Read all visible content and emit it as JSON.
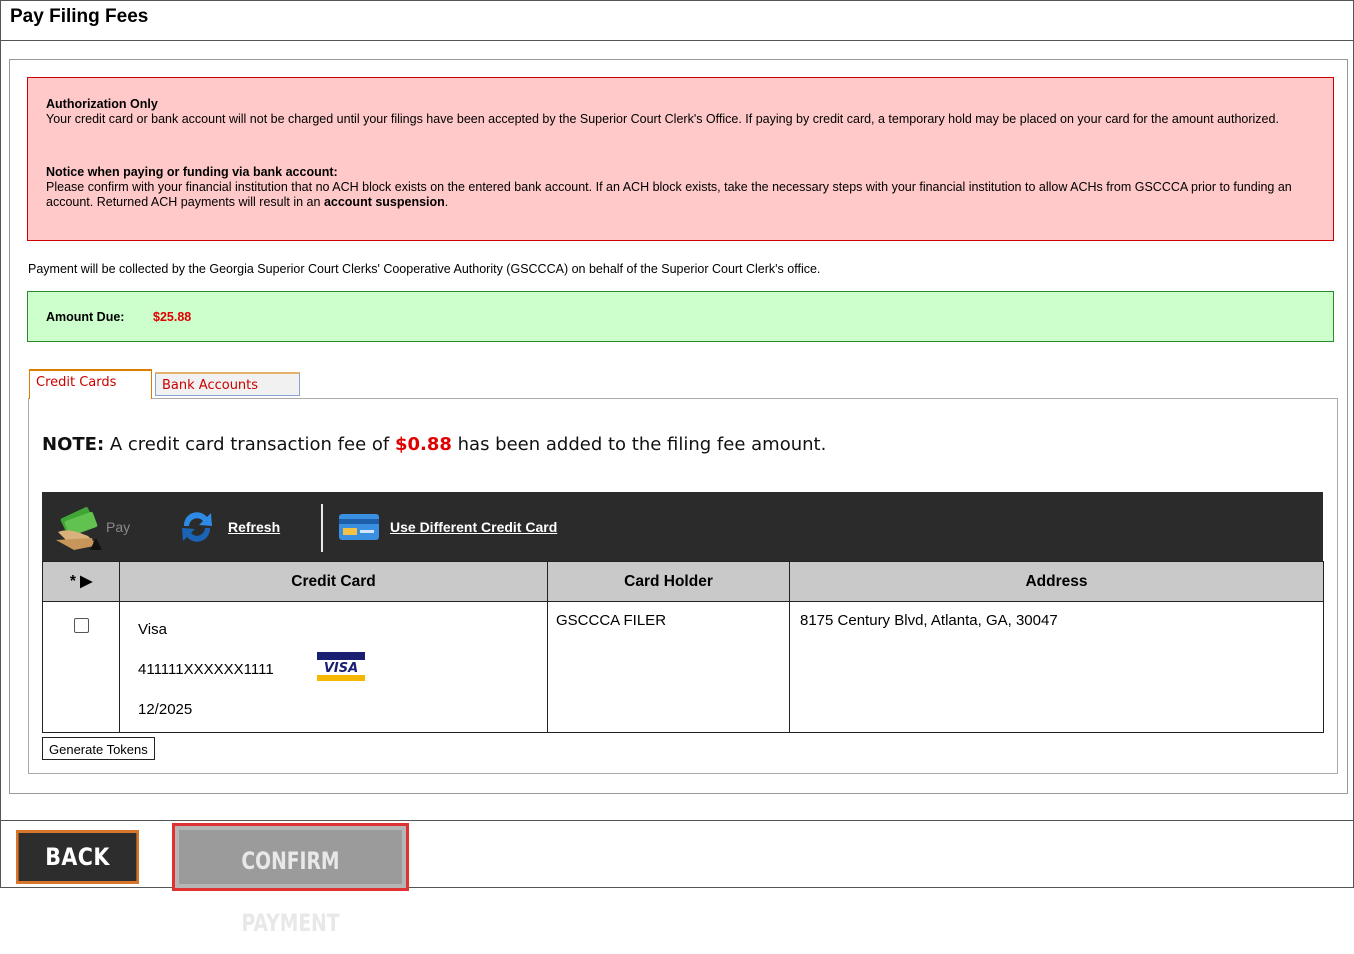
{
  "page": {
    "title": "Pay Filing Fees"
  },
  "authorization": {
    "heading": "Authorization Only",
    "text": "Your credit card or bank account will not be charged until your filings have been accepted by the Superior Court Clerk's Office. If paying by credit card, a temporary hold may be placed on your card for the amount authorized.",
    "notice_heading": "Notice when paying or funding via bank account:",
    "notice_text": "Please confirm with your financial institution that no ACH block exists on the entered bank account. If an ACH block exists, take the necessary steps with your financial institution to allow ACHs from GSCCCA prior to funding an account. Returned ACH payments will result in an",
    "notice_bold": "account suspension",
    "notice_end": "."
  },
  "collection_text": "Payment will be collected by the Georgia Superior Court Clerks' Cooperative Authority (GSCCCA) on behalf of the Superior Court Clerk's office.",
  "amount_due": {
    "label": "Amount Due:",
    "value": "$25.88"
  },
  "tabs": [
    {
      "label": "Credit Cards",
      "active": true
    },
    {
      "label": "Bank Accounts",
      "active": false
    }
  ],
  "note": {
    "prefix": "NOTE:",
    "text_before": "A credit card transaction fee of",
    "fee": "$0.88",
    "text_after": "has been added to the filing fee amount."
  },
  "toolbar": {
    "pay_label": "Pay",
    "refresh_label": "Refresh",
    "different_card_label": "Use Different Credit Card"
  },
  "grid": {
    "columns": [
      "* ▶",
      "Credit Card",
      "Card Holder",
      "Address"
    ],
    "rows": [
      {
        "card_type": "Visa",
        "card_number": "411111XXXXXX1111",
        "expiry": "12/2025",
        "card_brand_icon": "visa-logo",
        "card_holder": "GSCCCA FILER",
        "address": "8175 Century Blvd, Atlanta, GA, 30047",
        "selected": false
      }
    ]
  },
  "generate_tokens_label": "Generate Tokens",
  "buttons": {
    "back": "BACK",
    "confirm": "CONFIRM PAYMENT"
  },
  "colors": {
    "alert_bg": "#ffc9c9",
    "alert_border": "#cc0000",
    "success_bg": "#ccffcc",
    "amount": "#e00000"
  }
}
